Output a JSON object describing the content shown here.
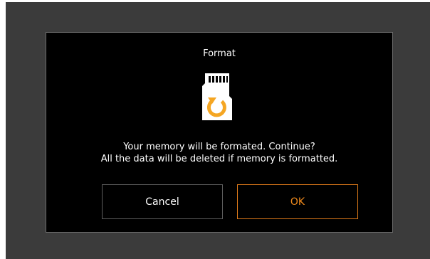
{
  "dialog": {
    "title": "Format",
    "icon": "sd-card-format-icon",
    "message_line1": "Your memory will be formated. Continue?",
    "message_line2": "All the data will be deleted if memory is formatted.",
    "cancel_label": "Cancel",
    "ok_label": "OK"
  },
  "colors": {
    "screen_background": "#3b3b3b",
    "dialog_background": "#000000",
    "accent": "#f08a1c",
    "icon_card": "#ffffff",
    "icon_arrow": "#f5a623"
  }
}
